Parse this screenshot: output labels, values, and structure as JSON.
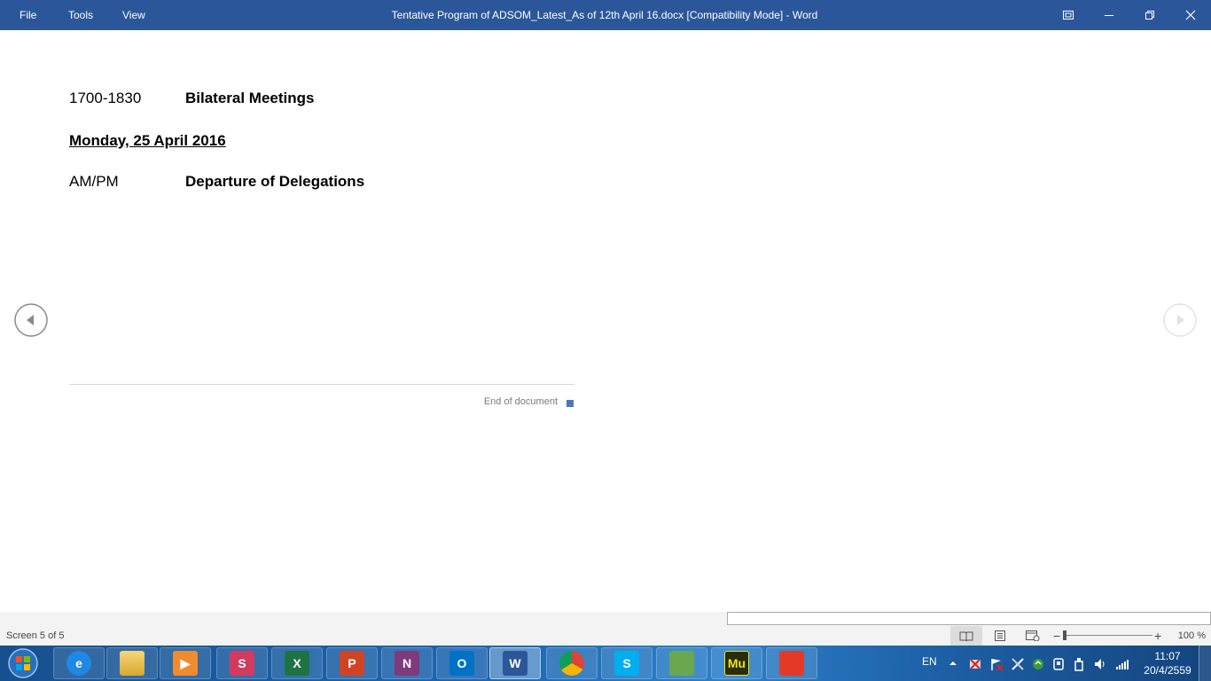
{
  "titlebar": {
    "menu": [
      "File",
      "Tools",
      "View"
    ],
    "title": "Tentative Program of ADSOM_Latest_As of 12th April  16.docx [Compatibility Mode] - Word"
  },
  "document": {
    "rows": [
      {
        "time": "1700-1830",
        "event": "Bilateral Meetings"
      },
      {
        "time": "AM/PM",
        "event": "Departure of Delegations"
      }
    ],
    "date_heading": "Monday, 25 April 2016",
    "end_of_document": "End of document"
  },
  "statusbar": {
    "screen": "Screen 5 of 5",
    "zoom": "100 %",
    "zoom_percent": 100
  },
  "taskbar": {
    "apps": [
      {
        "name": "internet-explorer-icon",
        "label": "e",
        "color": "#1e88e5"
      },
      {
        "name": "file-explorer-icon",
        "label": "",
        "color": "#e8c15a"
      },
      {
        "name": "media-player-icon",
        "label": "▶",
        "color": "#f08c2e"
      },
      {
        "name": "browser-swirl-icon",
        "label": "S",
        "color": "#d23b5e"
      },
      {
        "name": "excel-icon",
        "label": "X",
        "color": "#1f7244"
      },
      {
        "name": "powerpoint-icon",
        "label": "P",
        "color": "#d04423"
      },
      {
        "name": "onenote-icon",
        "label": "N",
        "color": "#80397b"
      },
      {
        "name": "outlook-icon",
        "label": "O",
        "color": "#0072c6"
      },
      {
        "name": "word-icon",
        "label": "W",
        "color": "#2b579a",
        "active": true
      },
      {
        "name": "chrome-icon",
        "label": "",
        "color": "#ffffff"
      },
      {
        "name": "skype-icon",
        "label": "S",
        "color": "#00aff0"
      },
      {
        "name": "network-people-icon",
        "label": "",
        "color": "#6aa84f"
      },
      {
        "name": "muse-icon",
        "label": "Mu",
        "color": "#2b2b0e"
      },
      {
        "name": "acrobat-icon",
        "label": "",
        "color": "#e23a26"
      }
    ],
    "language": "EN",
    "time": "11:07",
    "date": "20/4/2559"
  },
  "colors": {
    "title_bar": "#2b579a",
    "end_marker": "#4a78b8"
  }
}
